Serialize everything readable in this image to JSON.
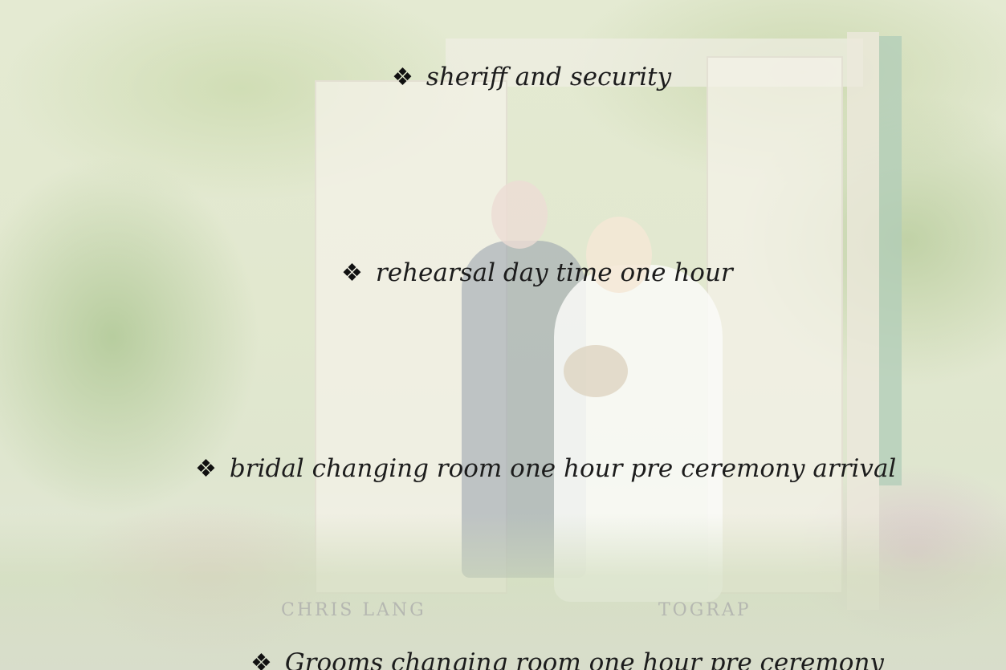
{
  "background": {
    "watermark_left": "CHRIS LANG",
    "watermark_right": "TOGRAP"
  },
  "items": [
    {
      "bullet": "❖",
      "text": "sheriff and security"
    },
    {
      "bullet": "❖",
      "text": "rehearsal day time one hour"
    },
    {
      "bullet": "❖",
      "text": "bridal changing room one hour pre ceremony arrival"
    },
    {
      "bullet": "❖",
      "text": "Grooms changing room one hour pre ceremony"
    }
  ],
  "colors": {
    "text": "#1c1c1c",
    "background_tint": "#e2e8cf"
  }
}
